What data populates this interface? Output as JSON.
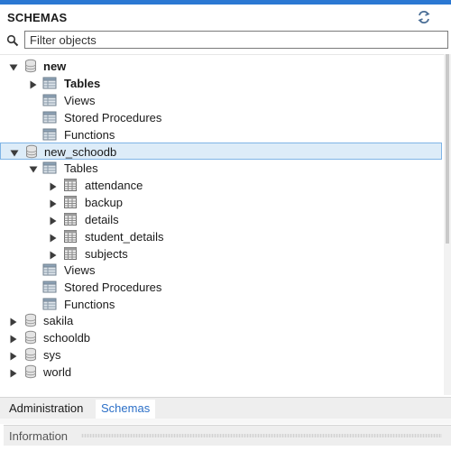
{
  "panel": {
    "title": "SCHEMAS"
  },
  "filter": {
    "placeholder": "Filter objects"
  },
  "tree": [
    {
      "label": "new",
      "icon": "database-icon",
      "state": "expanded",
      "bold": true
    },
    {
      "label": "Tables",
      "icon": "tables-folder-icon",
      "state": "collapsed",
      "bold": true
    },
    {
      "label": "Views",
      "icon": "views-folder-icon",
      "state": "none",
      "bold": false
    },
    {
      "label": "Stored Procedures",
      "icon": "procedures-folder-icon",
      "state": "none",
      "bold": false
    },
    {
      "label": "Functions",
      "icon": "functions-folder-icon",
      "state": "none",
      "bold": false
    },
    {
      "label": "new_schoodb",
      "icon": "database-icon",
      "state": "expanded",
      "bold": false,
      "selected": true
    },
    {
      "label": "Tables",
      "icon": "tables-folder-icon",
      "state": "expanded",
      "bold": false
    },
    {
      "label": "attendance",
      "icon": "table-icon",
      "state": "collapsed",
      "bold": false
    },
    {
      "label": "backup",
      "icon": "table-icon",
      "state": "collapsed",
      "bold": false
    },
    {
      "label": "details",
      "icon": "table-icon",
      "state": "collapsed",
      "bold": false
    },
    {
      "label": "student_details",
      "icon": "table-icon",
      "state": "collapsed",
      "bold": false
    },
    {
      "label": "subjects",
      "icon": "table-icon",
      "state": "collapsed",
      "bold": false
    },
    {
      "label": "Views",
      "icon": "views-folder-icon",
      "state": "none",
      "bold": false
    },
    {
      "label": "Stored Procedures",
      "icon": "procedures-folder-icon",
      "state": "none",
      "bold": false
    },
    {
      "label": "Functions",
      "icon": "functions-folder-icon",
      "state": "none",
      "bold": false
    },
    {
      "label": "sakila",
      "icon": "database-icon",
      "state": "collapsed",
      "bold": false
    },
    {
      "label": "schooldb",
      "icon": "database-icon",
      "state": "collapsed",
      "bold": false
    },
    {
      "label": "sys",
      "icon": "database-icon",
      "state": "collapsed",
      "bold": false
    },
    {
      "label": "world",
      "icon": "database-icon",
      "state": "collapsed",
      "bold": false
    }
  ],
  "tabs": [
    {
      "label": "Administration",
      "active": false
    },
    {
      "label": "Schemas",
      "active": true
    }
  ],
  "info": {
    "label": "Information"
  },
  "colors": {
    "accent": "#2b78d3",
    "selection": "#ddecf8",
    "active_tab_text": "#2b6fc7"
  }
}
